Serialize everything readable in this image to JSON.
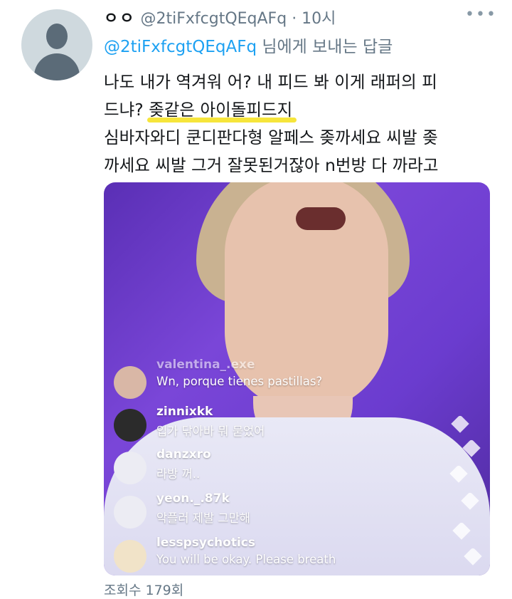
{
  "tweet": {
    "display_name": "ㅇㅇ",
    "handle": "@2tiFxfcgtQEqAFq",
    "time": "· 10시",
    "reply_prefix": "",
    "reply_handle": "@2tiFxfcgtQEqAFq",
    "reply_suffix": " 님에게 보내는 답글",
    "text_line1": "나도 내가 역겨워 어? 내 피드 봐 이게 래퍼의 피",
    "text_line2_before": "드냐? ",
    "text_line2_highlight": "좆같은 아이돌피드지",
    "text_line3": "심바자와디 쿤디판다형 알페스 좆까세요 씨발 좆",
    "text_line4": "까세요 씨발 그거 잘못된거잖아 n번방 다 까라고",
    "more_icon": "more-dots-icon",
    "highlight_color": "#f6e53b"
  },
  "media": {
    "comments": [
      {
        "user": "valentina_.exe",
        "text": "Wn, porque tienes pastillas?"
      },
      {
        "user": "zinnixkk",
        "text": "입가 닦아바 뭐 묻었어"
      },
      {
        "user": "danzxro",
        "text": "라방 꺼.."
      },
      {
        "user": "yeon._.87k",
        "text": "악플러 제발 그만해"
      },
      {
        "user": "lesspsychotics",
        "text": "You will be okay. Please breath"
      }
    ]
  },
  "footer": {
    "views": "조회수 179회"
  }
}
